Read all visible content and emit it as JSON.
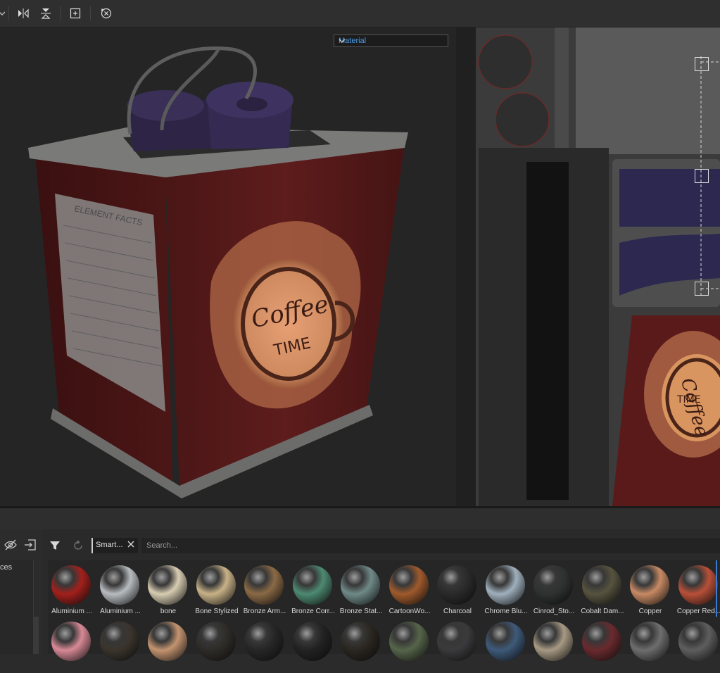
{
  "toolbar": {
    "icons": [
      "chevron-down-icon",
      "mirror-x-icon",
      "mirror-y-icon",
      "frame-icon",
      "reset-icon"
    ]
  },
  "viewport3d": {
    "channel_select": {
      "value": "Material"
    },
    "decal_lines": {
      "line1": "Coffee",
      "line2": "TIME"
    },
    "label_heading": "ELEMENT FACTS"
  },
  "viewport2d": {
    "decal_lines": {
      "line1": "Coffee",
      "line2": "TIME"
    }
  },
  "shelf": {
    "left_item": "ces",
    "filter_tag": "Smart...",
    "search_placeholder": "Search...",
    "row1": [
      {
        "label": "Aluminium ...",
        "color": "#a3201c"
      },
      {
        "label": "Aluminium ...",
        "color": "#b8bcc0"
      },
      {
        "label": "bone",
        "color": "#d8cdb2"
      },
      {
        "label": "Bone Stylized",
        "color": "#c9b288"
      },
      {
        "label": "Bronze Arm...",
        "color": "#8b6a45"
      },
      {
        "label": "Bronze Corr...",
        "color": "#4d8a72"
      },
      {
        "label": "Bronze Stat...",
        "color": "#6f8a88"
      },
      {
        "label": "CartoonWo...",
        "color": "#a05a2c"
      },
      {
        "label": "Charcoal",
        "color": "#2a2a2a"
      },
      {
        "label": "Chrome Blu...",
        "color": "#9fb0bd"
      },
      {
        "label": "Cinrod_Sto...",
        "color": "#2e3230"
      },
      {
        "label": "Cobalt Dam...",
        "color": "#57533f"
      },
      {
        "label": "Copper",
        "color": "#c88a64"
      },
      {
        "label": "Copper Red...",
        "color": "#b85038"
      }
    ],
    "row2": [
      {
        "color": "#d88a96"
      },
      {
        "color": "#3a342c"
      },
      {
        "color": "#c49470"
      },
      {
        "color": "#2e2c28"
      },
      {
        "color": "#262626"
      },
      {
        "color": "#222222"
      },
      {
        "color": "#2a2620"
      },
      {
        "color": "#56654a"
      },
      {
        "color": "#3a3a3c"
      },
      {
        "color": "#3e5a7a"
      },
      {
        "color": "#a89a84"
      },
      {
        "color": "#6a2a2e"
      },
      {
        "color": "#6e6e6e"
      },
      {
        "color": "#5e5e5e"
      }
    ]
  }
}
